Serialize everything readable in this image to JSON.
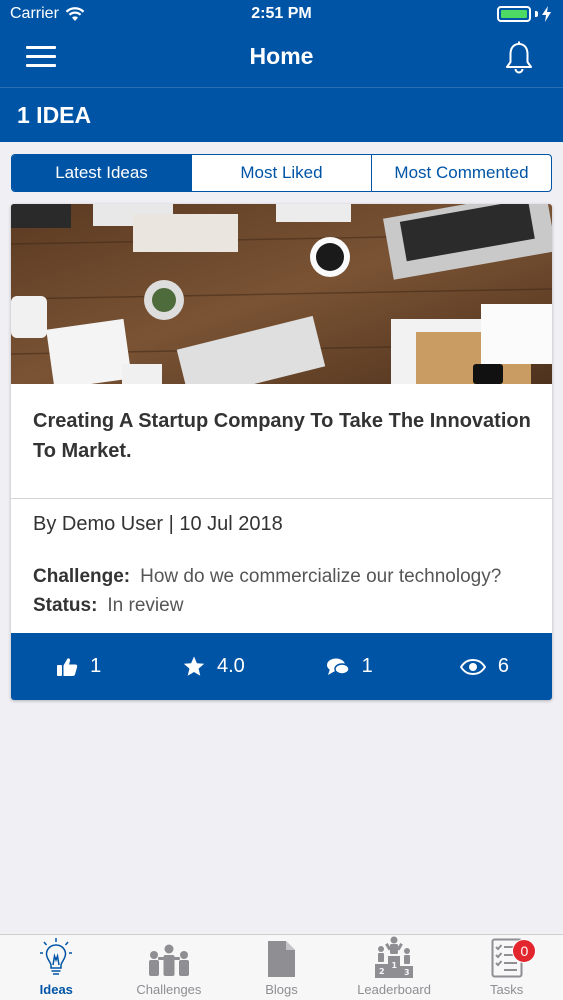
{
  "status_bar": {
    "carrier": "Carrier",
    "time": "2:51 PM"
  },
  "nav": {
    "title": "Home",
    "menu_icon": "hamburger-menu-icon",
    "bell_icon": "bell-icon"
  },
  "ideas_count_label": "1 IDEA",
  "segments": [
    {
      "label": "Latest Ideas",
      "active": true
    },
    {
      "label": "Most Liked",
      "active": false
    },
    {
      "label": "Most Commented",
      "active": false
    }
  ],
  "idea_card": {
    "title": "Creating A Startup Company To Take The Innovation To Market.",
    "byline": "By Demo User | 10 Jul 2018",
    "challenge_label": "Challenge:",
    "challenge_value": "How do we commercialize our technology?",
    "status_label": "Status:",
    "status_value": "In review",
    "stats": {
      "likes": "1",
      "rating": "4.0",
      "comments": "1",
      "views": "6"
    }
  },
  "tabbar": {
    "tabs": [
      {
        "label": "Ideas",
        "icon": "lightbulb-icon",
        "active": true
      },
      {
        "label": "Challenges",
        "icon": "people-group-icon",
        "active": false
      },
      {
        "label": "Blogs",
        "icon": "document-icon",
        "active": false
      },
      {
        "label": "Leaderboard",
        "icon": "podium-icon",
        "active": false
      },
      {
        "label": "Tasks",
        "icon": "checklist-icon",
        "active": false,
        "badge": "0"
      }
    ]
  },
  "colors": {
    "primary": "#0054a6",
    "background": "#efeff4",
    "badge": "#e3262e",
    "battery": "#4cd964"
  }
}
